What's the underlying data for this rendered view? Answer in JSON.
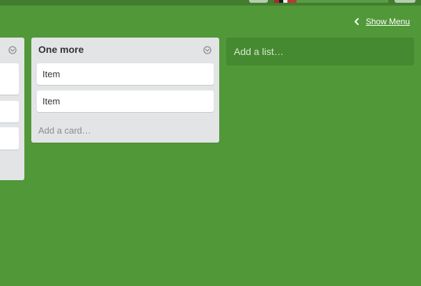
{
  "header": {
    "show_menu_label": "Show Menu"
  },
  "lists": [
    {
      "title": "",
      "cards": [
        "",
        "",
        ""
      ]
    },
    {
      "title": "One more",
      "cards": [
        "Item",
        "Item"
      ],
      "add_card_label": "Add a card…"
    }
  ],
  "add_list_label": "Add a list…",
  "icons": {
    "show_menu": "chevron-left-icon",
    "list_menu": "chevron-down-circle-icon"
  },
  "colors": {
    "board_background": "#519839",
    "header_background": "#427d2f",
    "list_background": "#e2e4e6",
    "add_list_background": "#458a30"
  }
}
